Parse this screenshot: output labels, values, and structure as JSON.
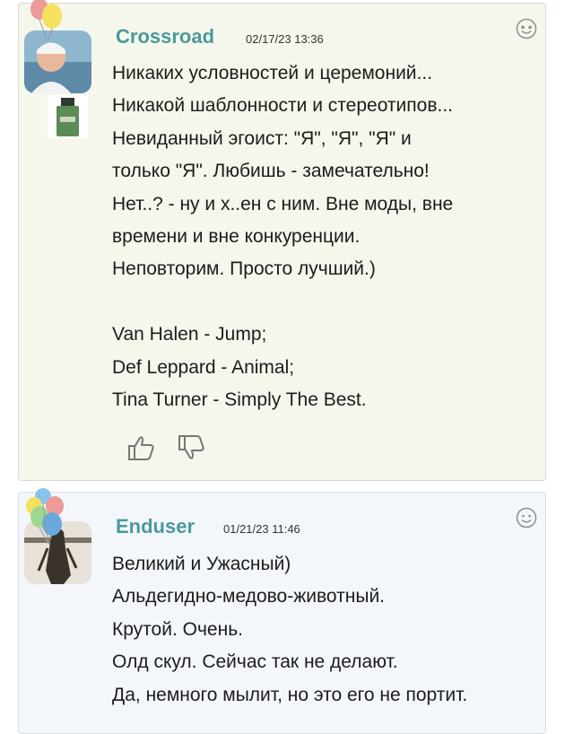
{
  "comments": [
    {
      "author": "Crossroad",
      "date": "02/17/23 13:36",
      "text": "Никаких условностей и церемоний...\nНикакой шаблонности и стереотипов...\nНевиданный эгоист: \"Я\", \"Я\", \"Я\" и\nтолько \"Я\". Любишь - замечательно!\nНет..? - ну и х..ен с ним. Вне моды, вне\nвремени и вне конкуренции.\nНеповторим. Просто лучший.)\n\nVan Halen - Jump;\nDef Leppard - Animal;\nTina Turner - Simply The Best.",
      "reaction_icon": "heart-eyes-smiley-icon",
      "accent": "#4a9a98"
    },
    {
      "author": "Enduser",
      "date": "01/21/23 11:46",
      "text": "Великий и Ужасный)\nАльдегидно-медово-животный.\nКрутой. Очень.\nОлд скул. Сейчас так не делают.\nДа, немного мылит, но это его не портит.",
      "reaction_icon": "smiley-icon",
      "accent": "#4a9a98"
    }
  ],
  "votes": {
    "like_icon": "thumbs-up-icon",
    "dislike_icon": "thumbs-down-icon"
  }
}
